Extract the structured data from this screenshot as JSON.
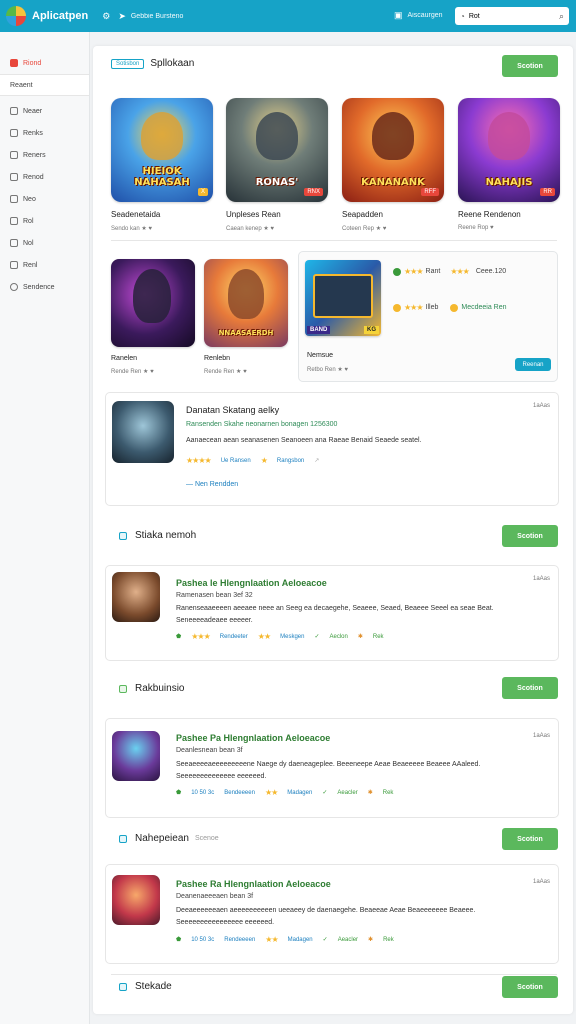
{
  "topbar": {
    "brand": "Aplicatpen",
    "nav_label": "Gebbie Bursteno",
    "right_label": "Aiscaurgen",
    "search_value": "Rot"
  },
  "sidebar": {
    "items": [
      {
        "label": "Riond",
        "icon": "home-icon"
      },
      {
        "label": "Reaent",
        "icon": "folder-icon"
      },
      {
        "label": "Neaer",
        "icon": "mail-icon"
      },
      {
        "label": "Renks",
        "icon": "list-icon"
      },
      {
        "label": "Reners",
        "icon": "grid-icon"
      },
      {
        "label": "Renod",
        "icon": "box-icon"
      },
      {
        "label": "Neo",
        "icon": "box-icon"
      },
      {
        "label": "Rol",
        "icon": "box-icon"
      },
      {
        "label": "Nol",
        "icon": "box-icon"
      },
      {
        "label": "Renl",
        "icon": "box-icon"
      },
      {
        "label": "Sendence",
        "icon": "gear-icon"
      }
    ]
  },
  "section1": {
    "tag": "Sotisbon",
    "title": "Spllokaan",
    "button": "Scotion",
    "tiles": [
      {
        "art_text": "HIEIOK NAHASAH",
        "badge": "X",
        "title": "Seadenetaida",
        "meta": "Sendo kan ★ ♥"
      },
      {
        "art_text": "RONAS'",
        "badge": "RNX",
        "title": "Unpleses Rean",
        "meta": "Caean kenep ★ ♥"
      },
      {
        "art_text": "KANANANK",
        "badge": "RFF",
        "title": "Seapadden",
        "meta": "Coteen Rep ★ ♥"
      },
      {
        "art_text": "NAHAJIS",
        "badge": "RR",
        "title": "Reene Rendenon",
        "meta": "Reene Rop ♥"
      }
    ]
  },
  "section2": {
    "tiles": [
      {
        "art_text": "",
        "title": "Ranelen",
        "meta": "Rende Ren ★ ♥"
      },
      {
        "art_text": "NNAASAERDH",
        "title": "Renlebn",
        "meta": "Rende Ren ★ ♥"
      }
    ],
    "card": {
      "art_label": "BAND",
      "art_badge": "KG",
      "title": "Nemsue",
      "meta": "Retbo Ren ★ ♥",
      "rating1_label": "Rant",
      "rating1_value": "Ceee.120",
      "rating2_label": "Illeb",
      "rating2_value": "Mecdeeia Ren",
      "button": "Reenan"
    }
  },
  "review1": {
    "title": "Danatan Skatang aelky",
    "subtitle": "Ransenden Skahe neonarnen bonagen 1256300",
    "body": "Aanaecean aean seanasenen Seanoeen ana Raeae Benaid Seaede seatel.",
    "stat1": "Ue Ransen",
    "stat2": "Rangsbon",
    "link": "Nen Rendden",
    "date": "1aAas"
  },
  "section3": {
    "title": "Stiaka nemoh",
    "button": "Scotion"
  },
  "review2": {
    "title": "Pashea le Hlengnlaation Aeloeacoe",
    "subtitle": "Ramenasen bean 3ef 32",
    "body": "Ranenseaaeeeen aeeaee neee an Seeg ea decaegehe, Seaeee, Seaed, Beaeee Seeel ea seae Beat.",
    "body2": "Seneeeeadeaee eeeeer.",
    "stat1": "Rendeeter",
    "stat2": "Meskgen",
    "stat3": "Aeclon",
    "stat4": "Rek",
    "date": "1aAas"
  },
  "section4": {
    "title": "Rakbuinsio",
    "button": "Scotion"
  },
  "review3": {
    "title": "Pashee Pa Hlengnlaation Aeloeacoe",
    "subtitle": "Deanlesnean bean 3f",
    "body": "Seeaeeeeaeeeeeeeeene Naege dy daeneageplee. Beeeneepe Aeae Beaeeeee Beaeee AAaleed.",
    "body2": "Seeeeeeeeeeeeee eeeeeed.",
    "stat1": "10 50 3c",
    "stat2": "Bendeeeen",
    "stat3": "Madagen",
    "stat4": "Aeacler",
    "stat5": "Rek",
    "date": "1aAas"
  },
  "section5": {
    "title": "Nahepeiean",
    "subtitle": "Scenoe",
    "button": "Scotion"
  },
  "review4": {
    "title": "Pashee Ra Hlengnlaation Aeloeacoe",
    "subtitle": "Deanenaeeeaen bean 3f",
    "body": "Deeaeeeeeeaen aeeeeeeeeeen ueeaeey de daenaegehe. Beaeeae Aeae Beaeeeeeee Beaeee.",
    "body2": "Seeeeeeeeeeeeeeee eeeeeed.",
    "stat1": "10 50 3c",
    "stat2": "Rendeeeen",
    "stat3": "Madagen",
    "stat4": "Aeacler",
    "stat5": "Rek",
    "date": "1aAas"
  },
  "section6": {
    "title": "Stekade",
    "button": "Scotion"
  }
}
